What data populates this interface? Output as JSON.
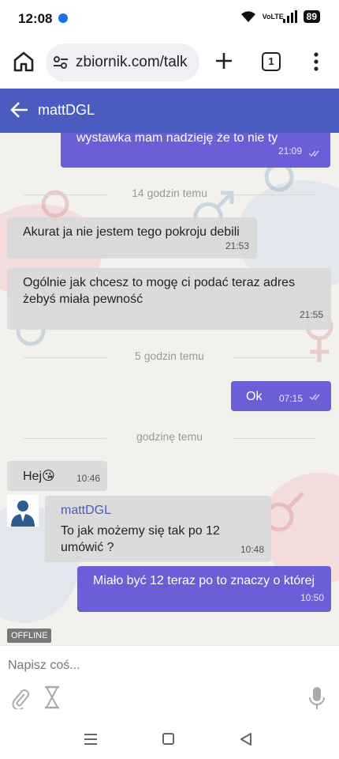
{
  "status_bar": {
    "time": "12:08",
    "network": "VoLTE",
    "battery": "89"
  },
  "browser": {
    "url": "zbiornik.com/talk",
    "tab_count": "1"
  },
  "chat": {
    "title": "mattDGL",
    "offline_label": "OFFLINE"
  },
  "messages": [
    {
      "dir": "out",
      "text": "wystawka mam nadzieję że to nie ty",
      "time": "21:09"
    },
    {
      "dir": "sep",
      "text": "14 godzin temu"
    },
    {
      "dir": "in",
      "text": "Akurat ja nie jestem tego pokroju debili",
      "time": "21:53"
    },
    {
      "dir": "in",
      "text": "Ogólnie jak chcesz to mogę ci podać teraz adres żebyś miała pewność",
      "time": "21:55"
    },
    {
      "dir": "sep",
      "text": "5 godzin temu"
    },
    {
      "dir": "out",
      "text": "Ok",
      "time": "07:15"
    },
    {
      "dir": "sep",
      "text": "godzinę temu"
    },
    {
      "dir": "in",
      "text": "Hej😘",
      "time": "10:46"
    },
    {
      "dir": "in",
      "sender": "mattDGL",
      "text": "To jak możemy się tak po 12 umówić ?",
      "time": "10:48"
    },
    {
      "dir": "out",
      "text": "Miało być 12 teraz po to znaczy o której",
      "time": "10:50"
    }
  ],
  "composer": {
    "placeholder": "Napisz coś..."
  },
  "colors": {
    "header": "#4a5cc0",
    "outgoing": "#6a5fd6",
    "incoming": "#d9d9d9"
  },
  "icons": [
    "home-icon",
    "site-settings-icon",
    "plus-icon",
    "tabs-icon",
    "more-vert-icon",
    "back-arrow-icon",
    "double-check-icon",
    "paperclip-icon",
    "hourglass-icon",
    "microphone-icon",
    "nav-menu-icon",
    "nav-home-icon",
    "nav-back-icon"
  ]
}
